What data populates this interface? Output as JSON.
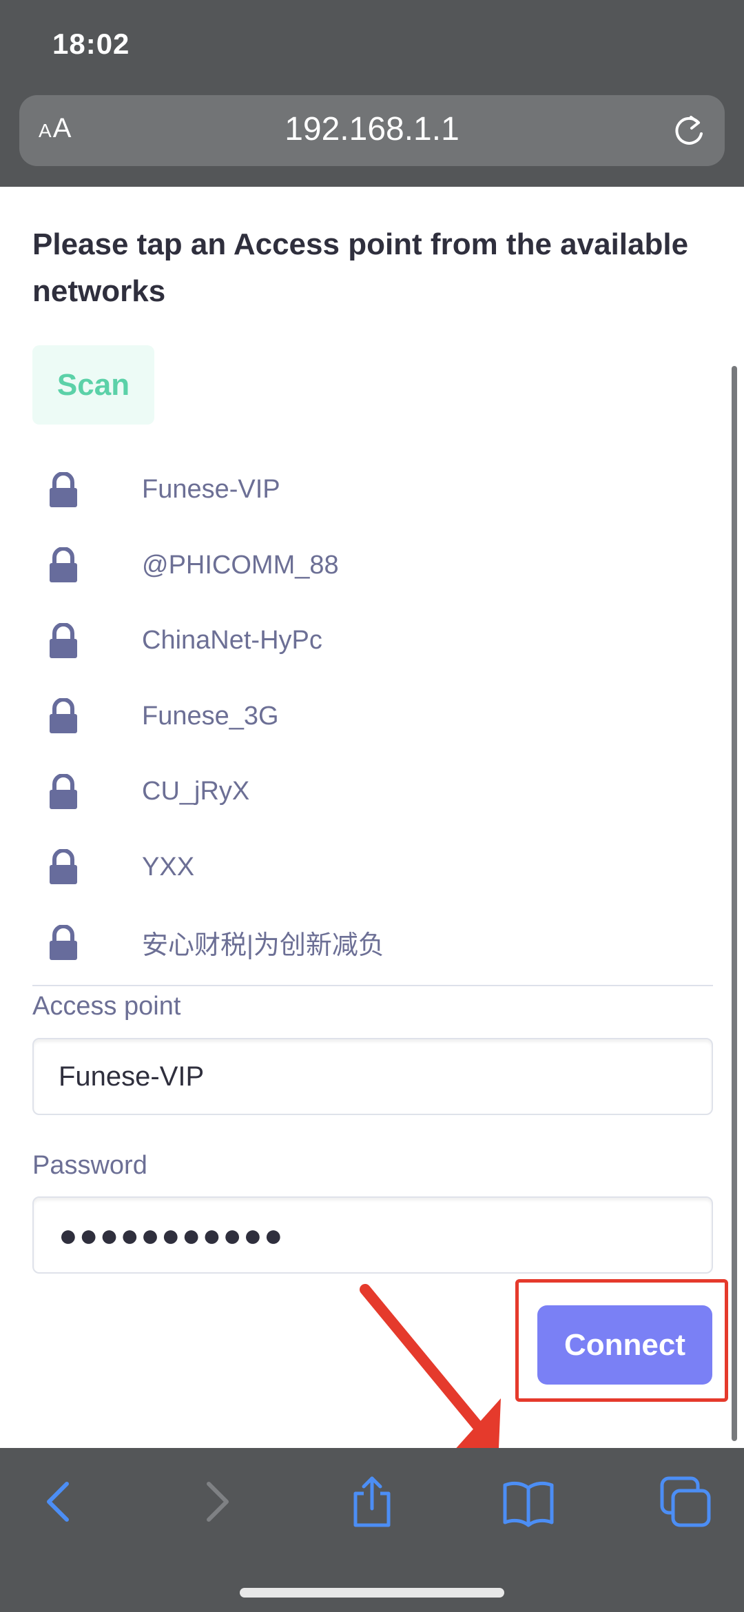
{
  "status_bar": {
    "time": "18:02"
  },
  "browser": {
    "text_size_small": "A",
    "text_size_large": "A",
    "url": "192.168.1.1"
  },
  "page": {
    "prompt": "Please tap an Access point from the available networks",
    "scan_label": "Scan",
    "networks": [
      {
        "name": "Funese-VIP",
        "icon": "lock-icon"
      },
      {
        "name": "@PHICOMM_88",
        "icon": "lock-icon"
      },
      {
        "name": "ChinaNet-HyPc",
        "icon": "lock-icon"
      },
      {
        "name": "Funese_3G",
        "icon": "lock-icon"
      },
      {
        "name": "CU_jRyX",
        "icon": "lock-icon"
      },
      {
        "name": "YXX",
        "icon": "lock-icon"
      },
      {
        "name": "安心财税|为创新减负",
        "icon": "lock-icon"
      }
    ],
    "access_point_label": "Access point",
    "access_point_value": "Funese-VIP",
    "password_label": "Password",
    "password_value": "●●●●●●●●●●●",
    "connect_label": "Connect"
  },
  "colors": {
    "chrome": "#545658",
    "accent": "#7a80f5",
    "scan": "#5bd1a8",
    "annotation": "#e53a2c",
    "toolbar_icon": "#4c8ef5"
  },
  "toolbar": {
    "icons": [
      "back-icon",
      "forward-icon",
      "share-icon",
      "bookmarks-icon",
      "tabs-icon"
    ]
  }
}
